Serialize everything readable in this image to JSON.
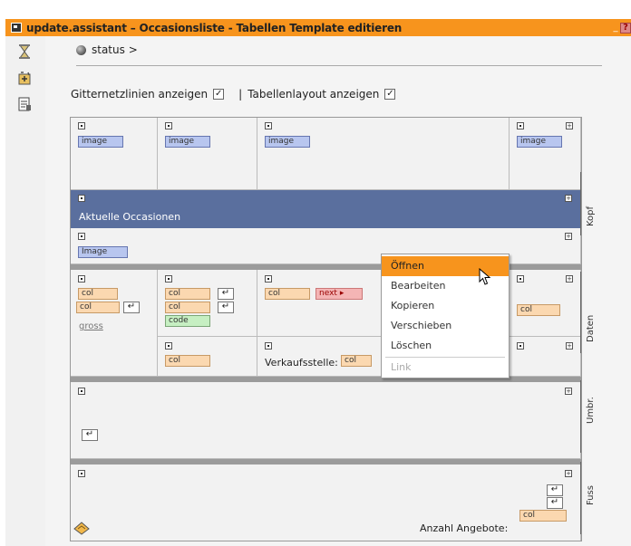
{
  "window": {
    "title": "update.assistant – Occasionsliste - Tabellen Template editieren",
    "min_glyph": "_",
    "close_glyph": "?"
  },
  "status": {
    "label": "status >"
  },
  "options": {
    "grid_label": "Gitternetzlinien anzeigen",
    "grid_checked": "✓",
    "separator": "|",
    "layout_label": "Tabellenlayout anzeigen",
    "layout_checked": "✓"
  },
  "header": {
    "images": [
      "image",
      "image",
      "image",
      "image"
    ],
    "banner_text": "Aktuelle Occasionen",
    "image_row": "Image"
  },
  "data_rows": {
    "col": "col",
    "next": "next",
    "next_arrow": "▸",
    "code": "code",
    "link": "gross",
    "return": "↵",
    "sales_label": "Verkaufsstelle:",
    "col_short": "col"
  },
  "footer": {
    "count_label": "Anzahl Angebote:",
    "count_col": "col"
  },
  "sections": [
    "Kopf",
    "Daten",
    "Umbr.",
    "Fuss"
  ],
  "context_menu": {
    "items": [
      "Öffnen",
      "Bearbeiten",
      "Kopieren",
      "Verschieben",
      "Löschen"
    ],
    "disabled": "Link"
  },
  "colors": {
    "accent": "#f7941d",
    "banner": "#5a6f9e"
  },
  "icons": {
    "window": "window-icon",
    "toolbar": [
      "hourglass-icon",
      "new-item-icon",
      "edit-document-icon"
    ],
    "status": "globe-icon",
    "bottom": "edit-pencil-icon",
    "cursor": "mouse-cursor-icon"
  }
}
